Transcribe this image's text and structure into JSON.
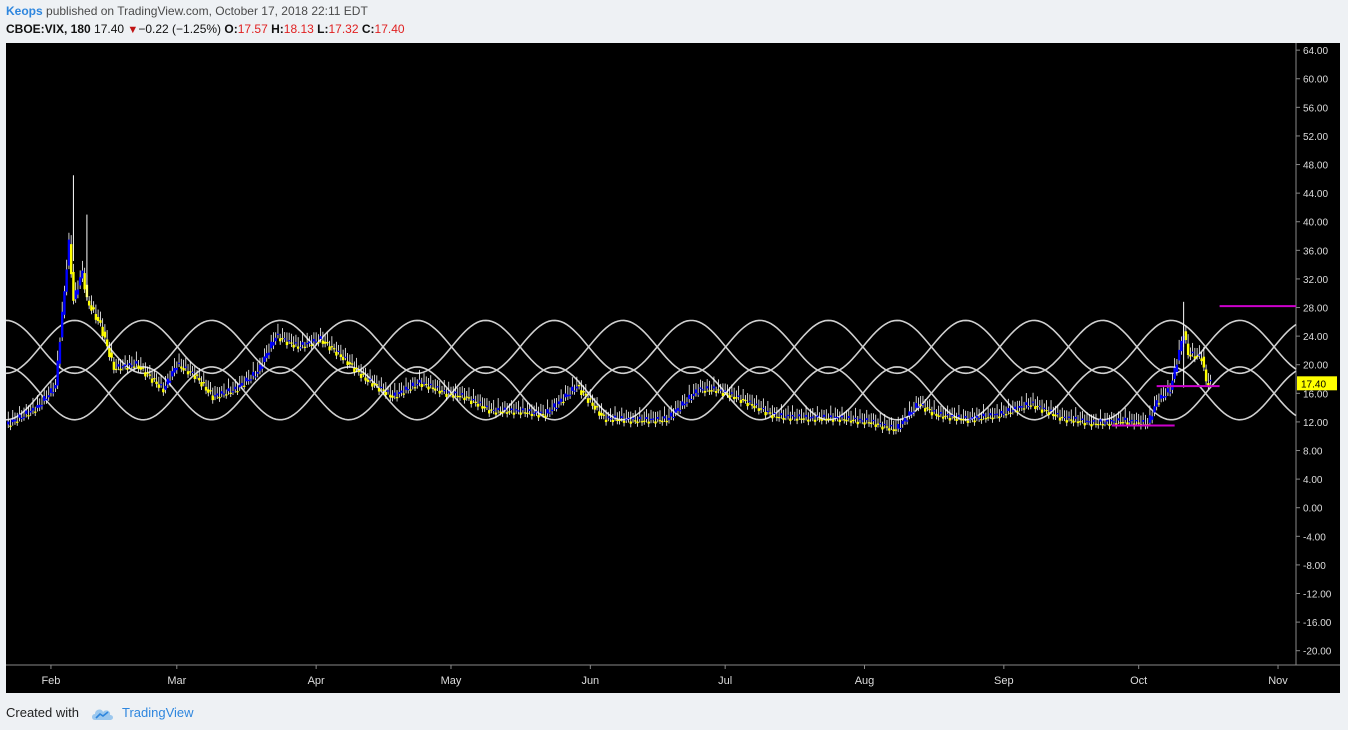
{
  "header": {
    "author": "Keops",
    "published_text": "published on TradingView.com, October 17, 2018 22:11 EDT",
    "symbol": "CBOE:VIX, 180",
    "last": "17.40",
    "change": "−0.22 (−1.25%)",
    "o_label": "O:",
    "o_value": "17.57",
    "h_label": "H:",
    "h_value": "18.13",
    "l_label": "L:",
    "l_value": "17.32",
    "c_label": "C:",
    "c_value": "17.40"
  },
  "footer": {
    "created_with": "Created with",
    "brand": "TradingView",
    "logo_icon": "tradingview-cloud-icon"
  },
  "colors": {
    "background": "#000000",
    "up": "#0000ff",
    "down": "#ffff00",
    "wick": "#ffffff",
    "waves": "#d0d0d0",
    "hline": "#cc00cc",
    "price_tag": "#ffff00",
    "accent": "#2e86de"
  },
  "chart_data": {
    "type": "candlestick",
    "ylim": [
      -22,
      65
    ],
    "y_ticks": [
      "64.00",
      "60.00",
      "56.00",
      "52.00",
      "48.00",
      "44.00",
      "40.00",
      "36.00",
      "32.00",
      "28.00",
      "24.00",
      "20.00",
      "16.00",
      "12.00",
      "8.00",
      "4.00",
      "0.00",
      "-4.00",
      "-8.00",
      "-12.00",
      "-16.00",
      "-20.00"
    ],
    "x_labels": [
      "Feb",
      "Mar",
      "Apr",
      "May",
      "Jun",
      "Jul",
      "Aug",
      "Sep",
      "Oct",
      "Nov"
    ],
    "x_label_dates": [
      "2018-02-01",
      "2018-03-01",
      "2018-04-01",
      "2018-05-01",
      "2018-06-01",
      "2018-07-01",
      "2018-08-01",
      "2018-09-01",
      "2018-10-01",
      "2018-11-01"
    ],
    "xlim": [
      "2018-01-22",
      "2018-11-05"
    ],
    "last_price": "17.40",
    "series": [
      {
        "date": "2018-01-22",
        "value": 11.5
      },
      {
        "date": "2018-01-29",
        "value": 14.0
      },
      {
        "date": "2018-02-02",
        "value": 17.0
      },
      {
        "date": "2018-02-05",
        "value": 37.0
      },
      {
        "date": "2018-02-06",
        "value": 29.0
      },
      {
        "date": "2018-02-08",
        "value": 33.0
      },
      {
        "date": "2018-02-09",
        "value": 29.0
      },
      {
        "date": "2018-02-12",
        "value": 25.5
      },
      {
        "date": "2018-02-15",
        "value": 19.5
      },
      {
        "date": "2018-02-20",
        "value": 20.0
      },
      {
        "date": "2018-02-26",
        "value": 16.5
      },
      {
        "date": "2018-03-01",
        "value": 20.0
      },
      {
        "date": "2018-03-05",
        "value": 18.5
      },
      {
        "date": "2018-03-09",
        "value": 15.5
      },
      {
        "date": "2018-03-14",
        "value": 16.5
      },
      {
        "date": "2018-03-19",
        "value": 19.0
      },
      {
        "date": "2018-03-23",
        "value": 24.0
      },
      {
        "date": "2018-03-28",
        "value": 22.5
      },
      {
        "date": "2018-04-02",
        "value": 23.5
      },
      {
        "date": "2018-04-06",
        "value": 21.5
      },
      {
        "date": "2018-04-12",
        "value": 18.0
      },
      {
        "date": "2018-04-18",
        "value": 15.5
      },
      {
        "date": "2018-04-24",
        "value": 17.5
      },
      {
        "date": "2018-04-30",
        "value": 16.0
      },
      {
        "date": "2018-05-04",
        "value": 15.5
      },
      {
        "date": "2018-05-10",
        "value": 13.5
      },
      {
        "date": "2018-05-16",
        "value": 13.5
      },
      {
        "date": "2018-05-22",
        "value": 13.0
      },
      {
        "date": "2018-05-29",
        "value": 17.0
      },
      {
        "date": "2018-06-04",
        "value": 12.5
      },
      {
        "date": "2018-06-11",
        "value": 12.2
      },
      {
        "date": "2018-06-18",
        "value": 12.3
      },
      {
        "date": "2018-06-25",
        "value": 16.5
      },
      {
        "date": "2018-06-29",
        "value": 16.5
      },
      {
        "date": "2018-07-05",
        "value": 15.0
      },
      {
        "date": "2018-07-12",
        "value": 12.8
      },
      {
        "date": "2018-07-19",
        "value": 12.5
      },
      {
        "date": "2018-07-26",
        "value": 12.5
      },
      {
        "date": "2018-08-02",
        "value": 12.0
      },
      {
        "date": "2018-08-08",
        "value": 10.9
      },
      {
        "date": "2018-08-13",
        "value": 14.5
      },
      {
        "date": "2018-08-17",
        "value": 13.0
      },
      {
        "date": "2018-08-24",
        "value": 12.3
      },
      {
        "date": "2018-08-31",
        "value": 13.0
      },
      {
        "date": "2018-09-07",
        "value": 14.5
      },
      {
        "date": "2018-09-14",
        "value": 12.5
      },
      {
        "date": "2018-09-21",
        "value": 11.8
      },
      {
        "date": "2018-09-28",
        "value": 12.1
      },
      {
        "date": "2018-10-03",
        "value": 11.7
      },
      {
        "date": "2018-10-05",
        "value": 14.8
      },
      {
        "date": "2018-10-08",
        "value": 16.5
      },
      {
        "date": "2018-10-11",
        "value": 24.5
      },
      {
        "date": "2018-10-12",
        "value": 21.5
      },
      {
        "date": "2018-10-15",
        "value": 21.0
      },
      {
        "date": "2018-10-16",
        "value": 17.6
      },
      {
        "date": "2018-10-17",
        "value": 17.4
      }
    ],
    "spikes": [
      {
        "date": "2018-02-06",
        "high": 46.5
      },
      {
        "date": "2018-02-09",
        "high": 41.0
      },
      {
        "date": "2018-10-11",
        "high": 28.8
      }
    ],
    "horizontal_lines": [
      {
        "value": 28.2,
        "from": "2018-10-19",
        "to": "2018-11-05"
      },
      {
        "value": 11.5,
        "from": "2018-09-25",
        "to": "2018-10-09"
      },
      {
        "value": 17.0,
        "from": "2018-10-05",
        "to": "2018-10-19"
      }
    ],
    "sine_bands": [
      {
        "center": 16.0,
        "amplitude": 3.7,
        "period_days": 30.5
      },
      {
        "center": 22.5,
        "amplitude": 3.7,
        "period_days": 30.5
      }
    ]
  }
}
